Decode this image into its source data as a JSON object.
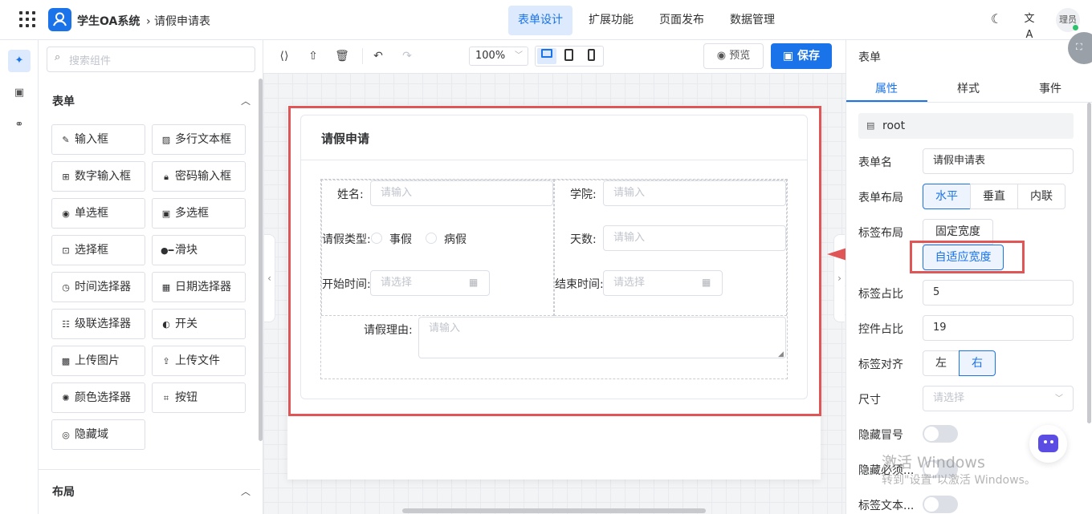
{
  "header": {
    "app_title": "学生OA系统",
    "breadcrumb": "› 请假申请表",
    "nav": [
      "表单设计",
      "扩展功能",
      "页面发布",
      "数据管理"
    ],
    "avatar_text": "理员"
  },
  "components": {
    "search_placeholder": "搜索组件",
    "section_form": "表单",
    "section_layout": "布局",
    "items": [
      "输入框",
      "多行文本框",
      "数字输入框",
      "密码输入框",
      "单选框",
      "多选框",
      "选择框",
      "滑块",
      "时间选择器",
      "日期选择器",
      "级联选择器",
      "开关",
      "上传图片",
      "上传文件",
      "颜色选择器",
      "按钮",
      "隐藏域"
    ]
  },
  "toolbar": {
    "zoom": "100%",
    "preview": "预览",
    "save": "保存"
  },
  "form": {
    "title": "请假申请",
    "name_label": "姓名:",
    "name_ph": "请输入",
    "college_label": "学院:",
    "college_ph": "请输入",
    "leave_type_label": "请假类型:",
    "leave_opt1": "事假",
    "leave_opt2": "病假",
    "days_label": "天数:",
    "days_ph": "请输入",
    "start_label": "开始时间:",
    "start_ph": "请选择",
    "end_label": "结束时间:",
    "end_ph": "请选择",
    "reason_label": "请假理由:",
    "reason_ph": "请输入"
  },
  "props": {
    "header": "表单",
    "tabs": [
      "属性",
      "样式",
      "事件"
    ],
    "root": "root",
    "form_name_label": "表单名",
    "form_name": "请假申请表",
    "layout_label": "表单布局",
    "layout_opts": [
      "水平",
      "垂直",
      "内联"
    ],
    "label_layout_label": "标签布局",
    "label_layout_opts": [
      "固定宽度",
      "自适应宽度"
    ],
    "label_ratio_label": "标签占比",
    "label_ratio": "5",
    "ctrl_ratio_label": "控件占比",
    "ctrl_ratio": "19",
    "align_label": "标签对齐",
    "align_opts": [
      "左",
      "右"
    ],
    "size_label": "尺寸",
    "size_ph": "请选择",
    "hide_colon_label": "隐藏冒号",
    "hide_req_label": "隐藏必须...",
    "label_text_label": "标签文本..."
  },
  "watermark": {
    "line1": "激活 Windows",
    "line2": "转到\"设置\"以激活 Windows。"
  }
}
